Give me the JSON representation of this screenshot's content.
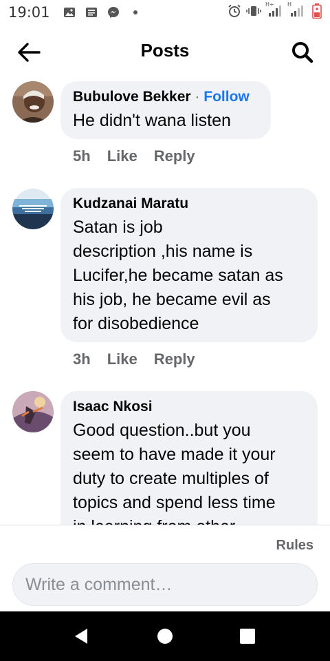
{
  "status_bar": {
    "time": "19:01",
    "icons_left": [
      "image-icon",
      "news-icon",
      "messenger-icon",
      "dot-icon"
    ],
    "icons_right": [
      "alarm-icon",
      "vibrate-icon",
      "signal-icon",
      "signal-icon",
      "battery-icon"
    ],
    "network_1": "H+",
    "network_2": "H"
  },
  "header": {
    "title": "Posts"
  },
  "comments": [
    {
      "author": "Bubulove Bekker",
      "separator": "·",
      "follow_label": "Follow",
      "text": "He didn't wana listen",
      "time": "5h",
      "like_label": "Like",
      "reply_label": "Reply"
    },
    {
      "author": "Kudzanai Maratu",
      "text_lines": [
        "Satan is job",
        "description ,his name is",
        "Lucifer,he became satan as",
        "his job, he became evil as",
        "for disobedience"
      ],
      "time": "3h",
      "like_label": "Like",
      "reply_label": "Reply"
    },
    {
      "author": "Isaac Nkosi",
      "text_lines": [
        "Good question..but you",
        "seem to have made it your",
        "duty to create multiples of",
        "topics and spend less time",
        "in learning from other"
      ]
    }
  ],
  "footer": {
    "rules_label": "Rules",
    "comment_placeholder": "Write a comment…"
  },
  "colors": {
    "accent": "#1877f2",
    "bubble": "#f0f2f5",
    "secondary_text": "#65676b"
  }
}
